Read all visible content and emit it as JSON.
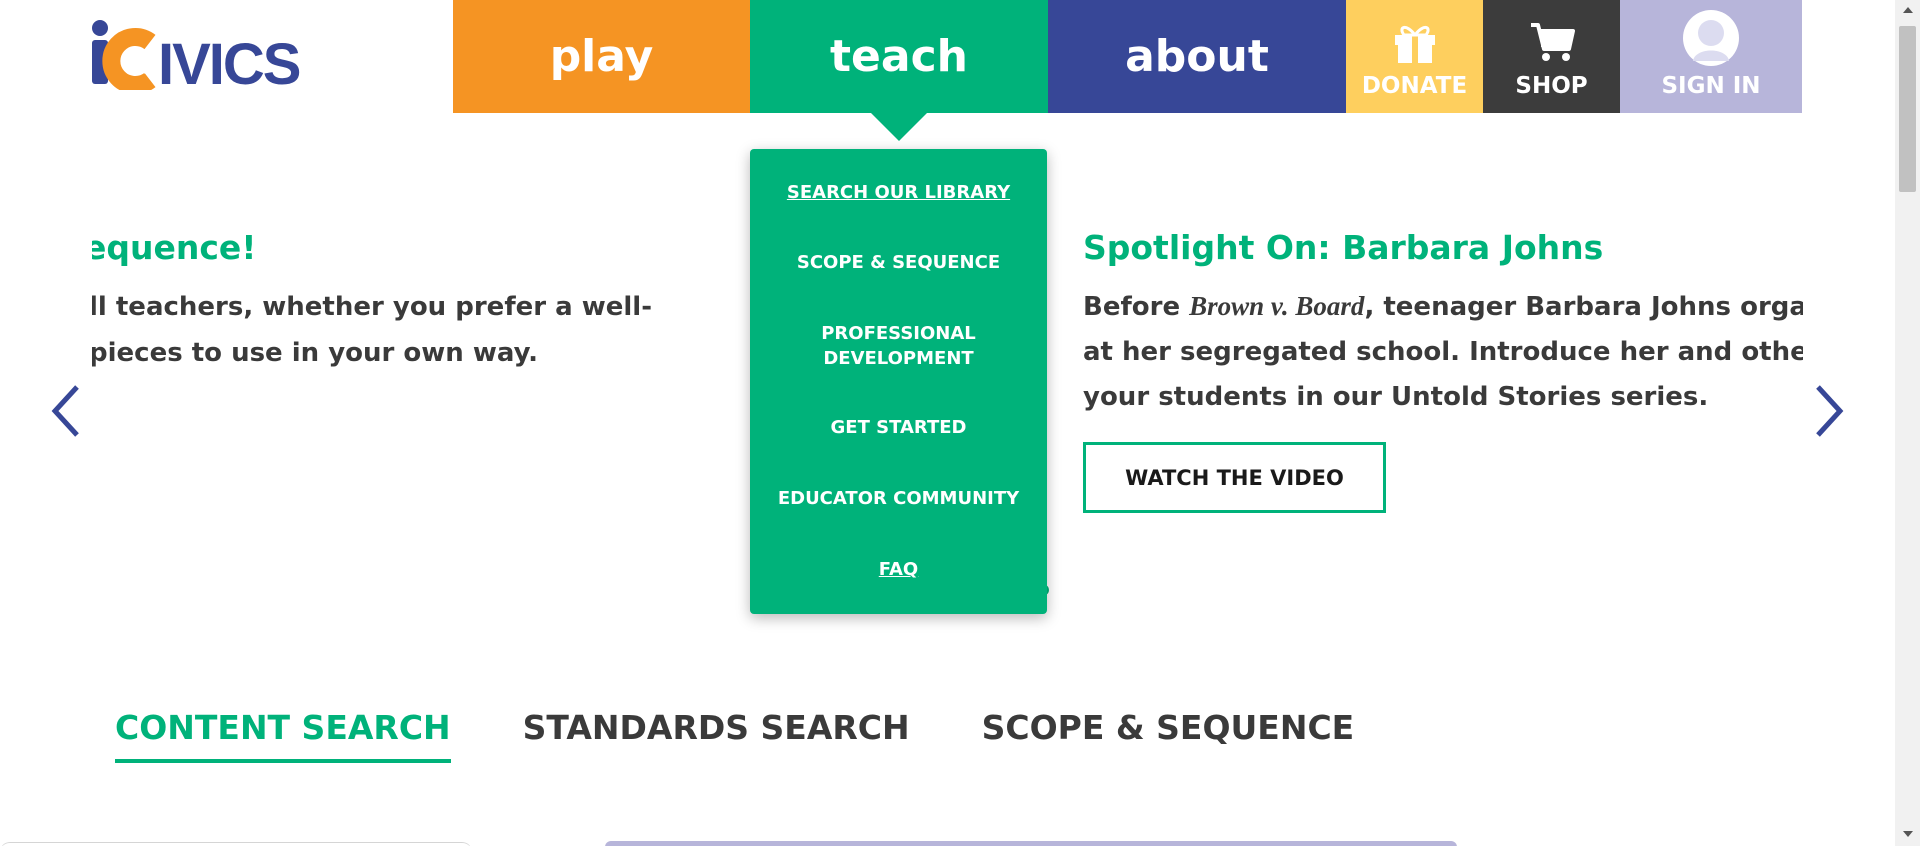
{
  "header": {
    "logo_text": "iCivics",
    "nav": {
      "play": "play",
      "teach": "teach",
      "about": "about",
      "donate": "DONATE",
      "shop": "SHOP",
      "signin": "SIGN IN"
    }
  },
  "dropdown": {
    "items": [
      "SEARCH OUR LIBRARY",
      "SCOPE & SEQUENCE",
      "PROFESSIONAL",
      "DEVELOPMENT",
      "GET STARTED",
      "EDUCATOR COMMUNITY",
      "FAQ"
    ]
  },
  "carousel": {
    "left_slide": {
      "headline": "equence!",
      "line1": "ll teachers, whether you prefer a well-",
      "line2": "pieces to use in your own way."
    },
    "right_slide": {
      "headline": "Spotlight On: Barbara Johns",
      "line1_prefix": "Before ",
      "line1_italic": "Brown v. Board",
      "line1_suffix": ", teenager Barbara Johns organize",
      "line2": "at her segregated school. Introduce her and other hid",
      "line3": "your students in our Untold Stories series.",
      "button": "WATCH THE VIDEO"
    }
  },
  "search_tabs": {
    "content": "CONTENT SEARCH",
    "standards": "STANDARDS SEARCH",
    "scope": "SCOPE & SEQUENCE"
  },
  "colors": {
    "play": "#f59423",
    "teach": "#00b27a",
    "about": "#374797",
    "donate": "#fecf5e",
    "shop": "#3c3c3c",
    "signin": "#b7b5da"
  },
  "icons": {
    "donate": "gift-icon",
    "shop": "cart-icon",
    "signin": "avatar-icon",
    "prev": "chevron-left-icon",
    "next": "chevron-right-icon"
  }
}
